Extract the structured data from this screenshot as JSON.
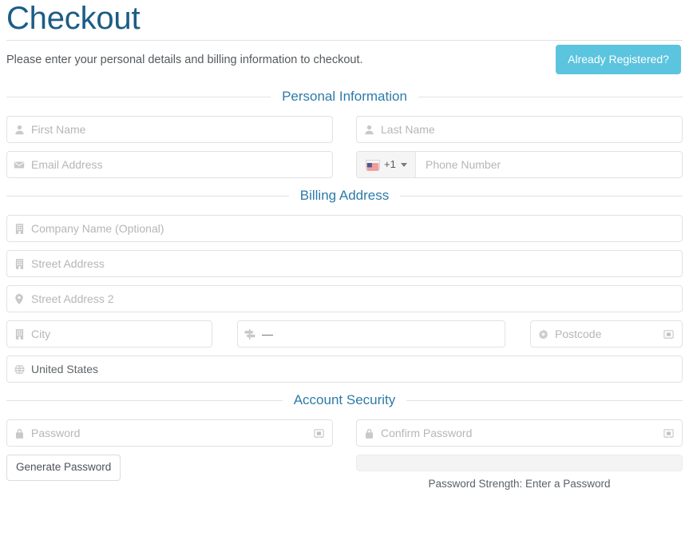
{
  "header": {
    "title": "Checkout",
    "lead": "Please enter your personal details and billing information to checkout.",
    "already_registered_label": "Already Registered?"
  },
  "sections": {
    "personal": "Personal Information",
    "billing": "Billing Address",
    "security": "Account Security"
  },
  "fields": {
    "first_name": {
      "placeholder": "First Name",
      "icon": "user-icon"
    },
    "last_name": {
      "placeholder": "Last Name",
      "icon": "user-icon"
    },
    "email": {
      "placeholder": "Email Address",
      "icon": "envelope-icon"
    },
    "phone": {
      "placeholder": "Phone Number",
      "dial_code": "+1",
      "flag": "us-flag-icon"
    },
    "company": {
      "placeholder": "Company Name (Optional)",
      "icon": "building-icon"
    },
    "street1": {
      "placeholder": "Street Address",
      "icon": "building-icon"
    },
    "street2": {
      "placeholder": "Street Address 2",
      "icon": "map-pin-icon"
    },
    "city": {
      "placeholder": "City",
      "icon": "building-icon"
    },
    "state": {
      "value": "—",
      "icon": "map-signs-icon"
    },
    "postcode": {
      "placeholder": "Postcode",
      "icon": "gear-icon"
    },
    "country": {
      "value": "United States",
      "icon": "globe-icon"
    },
    "password": {
      "placeholder": "Password",
      "icon": "lock-icon"
    },
    "confirm_password": {
      "placeholder": "Confirm Password",
      "icon": "lock-icon"
    }
  },
  "security": {
    "generate_password_label": "Generate Password",
    "strength_text": "Password Strength: Enter a Password",
    "strength_percent": 0
  },
  "colors": {
    "title_blue": "#1c5d86",
    "section_blue": "#2d7ba8",
    "button_blue": "#5bc4de",
    "border_gray": "#e2e2e2",
    "placeholder_gray": "#b6b6b6"
  }
}
